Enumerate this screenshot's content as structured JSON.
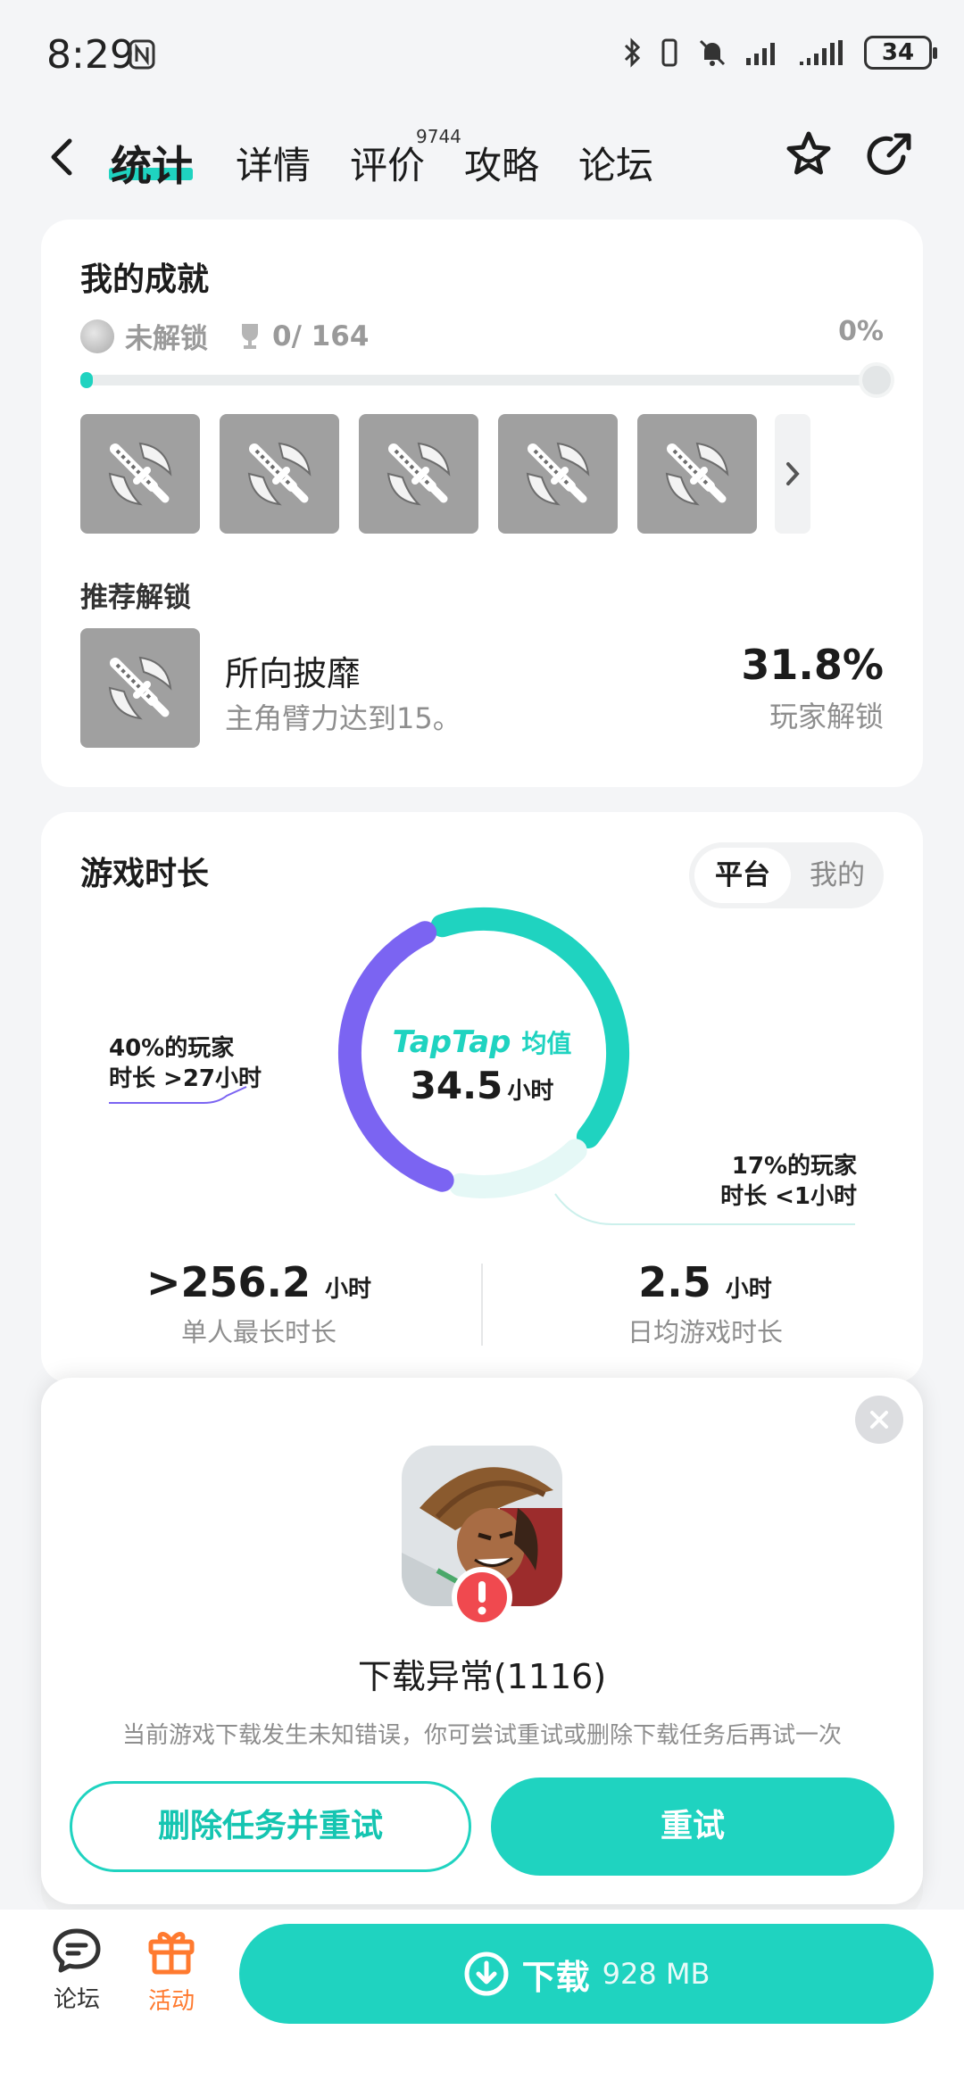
{
  "status_bar": {
    "time": "8:29",
    "battery": "34"
  },
  "nav": {
    "tabs": [
      {
        "label": "统计"
      },
      {
        "label": "详情"
      },
      {
        "label": "评价"
      },
      {
        "label": "攻略"
      },
      {
        "label": "论坛"
      }
    ],
    "review_count": "9744"
  },
  "achievements": {
    "title": "我的成就",
    "lock_status": "未解锁",
    "trophy_count": "0/ 164",
    "percent": "0%",
    "progress": 0,
    "recommend_title": "推荐解锁",
    "recommend": {
      "name": "所向披靡",
      "desc": "主角臂力达到15。",
      "pct": "31.8%",
      "pct_label": "玩家解锁"
    }
  },
  "playtime": {
    "title": "游戏时长",
    "toggle": {
      "on": "平台",
      "off": "我的"
    },
    "avg_brand": "TapTap",
    "avg_suffix": "均值",
    "avg_value": "34.5",
    "avg_unit": "小时",
    "left_note_line1": "40%的玩家",
    "left_note_line2": "时长 >27小时",
    "right_note_line1": "17%的玩家",
    "right_note_line2": "时长 <1小时",
    "longest_value": ">256.2",
    "longest_unit": "小时",
    "longest_label": "单人最长时长",
    "daily_value": "2.5",
    "daily_unit": "小时",
    "daily_label": "日均游戏时长",
    "segments": {
      "purple_pct": 40,
      "teal_pct": 43,
      "light_pct": 17
    },
    "colors": {
      "teal": "#1fd3c0",
      "purple": "#7b64f2",
      "light": "#e5f8f6"
    }
  },
  "dialog": {
    "title": "下载异常(1116)",
    "desc": "当前游戏下载发生未知错误，你可尝试重试或删除下载任务后再试一次",
    "btn_delete": "删除任务并重试",
    "btn_retry": "重试"
  },
  "bottom": {
    "forum": "论坛",
    "activity": "活动",
    "download": "下载",
    "size": "928 MB"
  }
}
